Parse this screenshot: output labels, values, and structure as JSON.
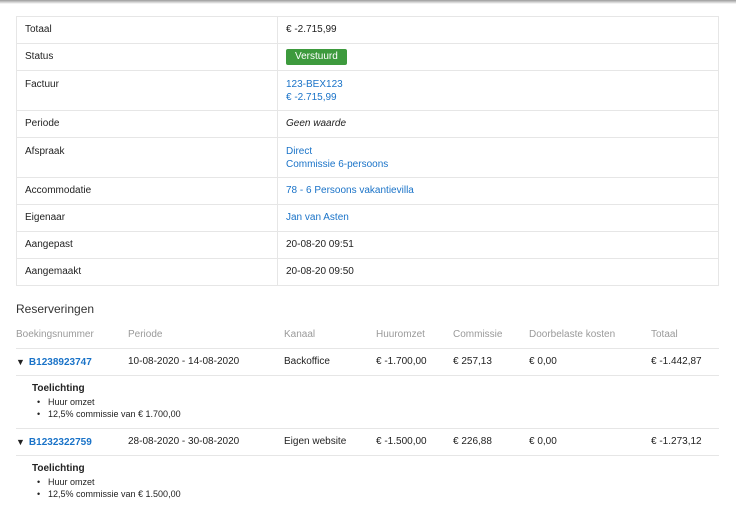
{
  "details": {
    "totaal_label": "Totaal",
    "totaal_value": "€ -2.715,99",
    "status_label": "Status",
    "status_value": "Verstuurd",
    "factuur_label": "Factuur",
    "factuur_number": "123-BEX123",
    "factuur_amount": "€ -2.715,99",
    "periode_label": "Periode",
    "periode_value": "Geen waarde",
    "afspraak_label": "Afspraak",
    "afspraak_line1": "Direct",
    "afspraak_line2": "Commissie 6-persoons",
    "accommodatie_label": "Accommodatie",
    "accommodatie_value": "78 - 6 Persoons vakantievilla",
    "eigenaar_label": "Eigenaar",
    "eigenaar_value": "Jan van Asten",
    "aangepast_label": "Aangepast",
    "aangepast_value": "20-08-20 09:51",
    "aangemaakt_label": "Aangemaakt",
    "aangemaakt_value": "20-08-20 09:50"
  },
  "reserveringen": {
    "title": "Reserveringen",
    "columns": [
      "Boekingsnummer",
      "Periode",
      "Kanaal",
      "Huuromzet",
      "Commissie",
      "Doorbelaste kosten",
      "Totaal"
    ],
    "rows": [
      {
        "booking": "B1238923747",
        "periode": "10-08-2020 - 14-08-2020",
        "kanaal": "Backoffice",
        "huuromzet": "€ -1.700,00",
        "commissie": "€ 257,13",
        "kosten": "€ 0,00",
        "totaal": "€ -1.442,87",
        "note_title": "Toelichting",
        "note_items": [
          "Huur omzet",
          "12,5% commissie van € 1.700,00"
        ]
      },
      {
        "booking": "B1232322759",
        "periode": "28-08-2020 - 30-08-2020",
        "kanaal": "Eigen website",
        "huuromzet": "€ -1.500,00",
        "commissie": "€ 226,88",
        "kosten": "€ 0,00",
        "totaal": "€ -1.273,12",
        "note_title": "Toelichting",
        "note_items": [
          "Huur omzet",
          "12,5% commissie van € 1.500,00"
        ]
      }
    ]
  },
  "icons": {
    "expand": "triangle-down-icon"
  }
}
